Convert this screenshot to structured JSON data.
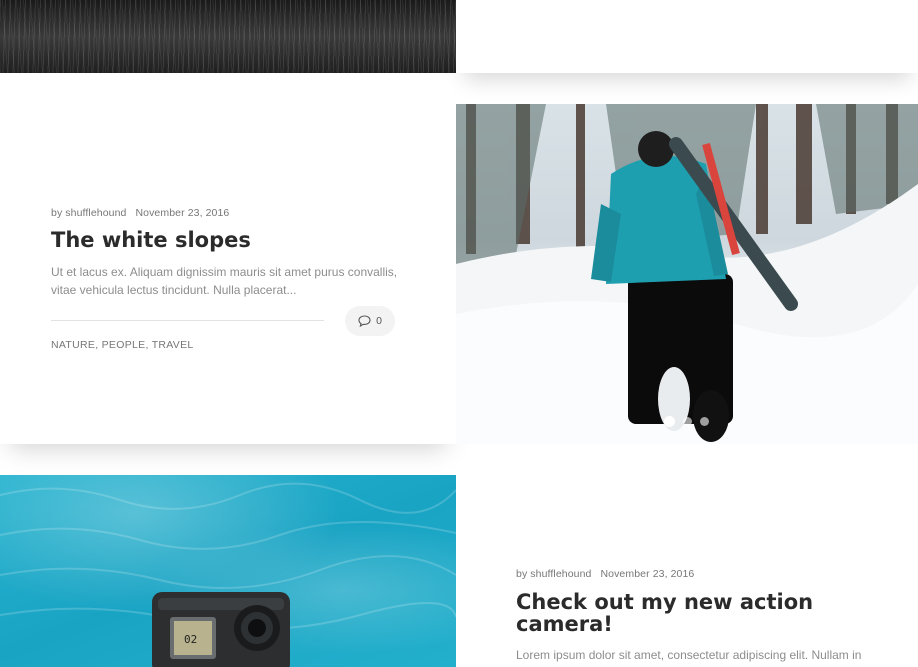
{
  "posts": [
    {
      "author": "by shufflehound",
      "date": "November 23, 2016",
      "title": "The white slopes",
      "excerpt_line1": "Ut et lacus ex. Aliquam dignissim mauris sit amet purus convallis,",
      "excerpt_line2": "vitae vehicula lectus tincidunt. Nulla placerat...",
      "comments": "0",
      "categories": "NATURE, PEOPLE, TRAVEL",
      "image_icon": "snowboarder-image"
    },
    {
      "author": "by shufflehound",
      "date": "November 23, 2016",
      "title_line1": "Check out my new action",
      "title_line2": "camera!",
      "excerpt": "Lorem ipsum dolor sit amet, consectetur adipiscing elit. Nullam in",
      "image_icon": "action-camera-image"
    }
  ],
  "camera_screen_text": "02",
  "slider": {
    "dots": 3,
    "active": 1
  },
  "colors": {
    "accent_teal": "#1aa4c4",
    "text_dark": "#2b2b2b",
    "text_muted": "#8d8d8d"
  }
}
